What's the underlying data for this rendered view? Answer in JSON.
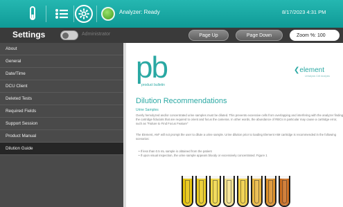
{
  "topbar": {
    "icons": [
      "test-tube-icon",
      "list-icon",
      "gear-icon"
    ],
    "status": "Analyzer: Ready",
    "datetime": "8/17/2023 4:31 PM"
  },
  "subbar": {
    "title": "Settings",
    "mode": "Administrator",
    "page_up": "Page Up",
    "page_down": "Page Down",
    "zoom": "Zoom %: 100"
  },
  "sidebar": {
    "items": [
      {
        "label": "About"
      },
      {
        "label": "General"
      },
      {
        "label": "Date/Time"
      },
      {
        "label": "DCU Client"
      },
      {
        "label": "Deleted Tests"
      },
      {
        "label": "Required Fields"
      },
      {
        "label": "Support Session"
      },
      {
        "label": "Product Manual"
      },
      {
        "label": "Dilution Guide",
        "active": true
      }
    ]
  },
  "document": {
    "logo": "pb",
    "logo_sub": "product bulletin",
    "brand": "element",
    "brand_tag": "Urinalysis Cell Analysis",
    "title": "Dilution Recommendations",
    "section": "Urine Samples",
    "para1": "Overly hemolyzed and/or concentrated urine samples must be diluted. This prevents excessive cells from overlapping and interfering with the analyzer finding the cartridge fiducials that are required to orient and focus the cameras. In other words, the abundance of RBCs in particular may cause a cartridge error, such as \"Failure to Find Focus Feature\"",
    "para2": "The Element, AM* will not prompt the user to dilute a urine sample. Urine dilution prior to loading Element AIM cartridge is recommended in the following scenarios:",
    "bullet1": "If less than 0.5 mL sample is obtained from the patient",
    "bullet2": "If upon visual inspection, the urine sample appears bloody or excessively concentrated. Figure 1",
    "tube_colors": [
      "#e6c200",
      "#e8c818",
      "#f0d640",
      "#f3e08a",
      "#f0cd3a",
      "#e9b53a",
      "#d98a1f",
      "#c96818"
    ]
  },
  "colors": {
    "accent": "#2aa8a3",
    "topbar": "#1aa9a4",
    "sidebar": "#4a4a4a",
    "sidebar_active": "#262626"
  }
}
